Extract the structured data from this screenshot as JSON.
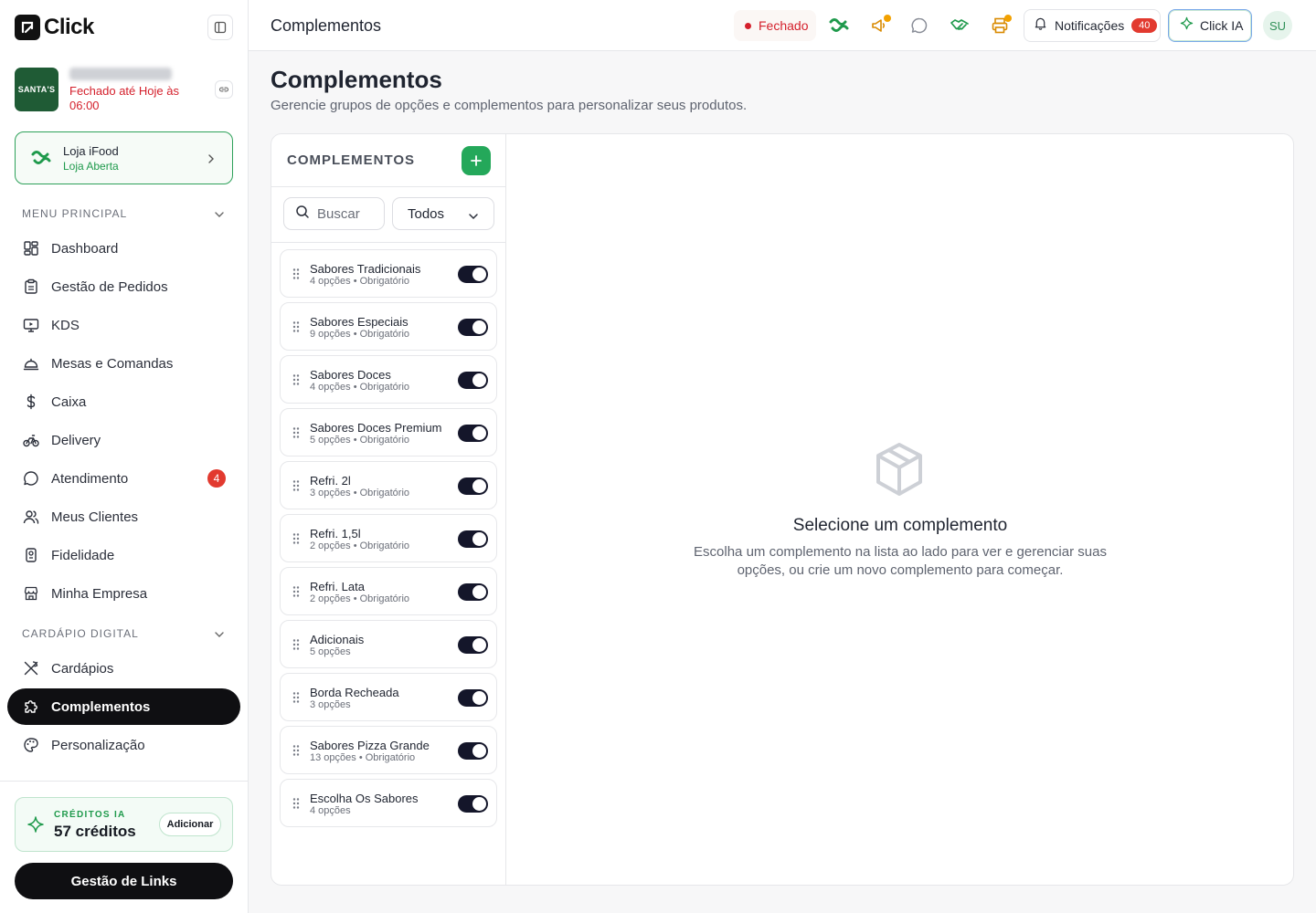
{
  "app": {
    "name": "Click"
  },
  "store": {
    "logo_text": "SANTA'S",
    "status": "Fechado até Hoje às 06:00"
  },
  "ifood_card": {
    "title": "Loja iFood",
    "status": "Loja Aberta"
  },
  "sidebar": {
    "sections": [
      {
        "label": "MENU PRINCIPAL"
      },
      {
        "label": "CARDÁPIO DIGITAL"
      }
    ],
    "items": [
      {
        "label": "Dashboard",
        "icon": "dashboard-icon"
      },
      {
        "label": "Gestão de Pedidos",
        "icon": "clipboard-icon"
      },
      {
        "label": "KDS",
        "icon": "monitor-icon"
      },
      {
        "label": "Mesas e Comandas",
        "icon": "cloche-icon"
      },
      {
        "label": "Caixa",
        "icon": "dollar-icon"
      },
      {
        "label": "Delivery",
        "icon": "bike-icon"
      },
      {
        "label": "Atendimento",
        "icon": "chat-icon",
        "badge": "4"
      },
      {
        "label": "Meus Clientes",
        "icon": "users-icon"
      },
      {
        "label": "Fidelidade",
        "icon": "loyalty-icon"
      },
      {
        "label": "Minha Empresa",
        "icon": "store-icon"
      },
      {
        "label": "Cardápios",
        "icon": "utensils-icon"
      },
      {
        "label": "Complementos",
        "icon": "puzzle-icon",
        "active": true
      },
      {
        "label": "Personalização",
        "icon": "palette-icon"
      }
    ]
  },
  "credits": {
    "label": "CRÉDITOS IA",
    "value": "57 créditos",
    "add_label": "Adicionar"
  },
  "footer": {
    "links_label": "Gestão de Links"
  },
  "topbar": {
    "title": "Complementos",
    "status": "Fechado",
    "notifications_label": "Notificações",
    "notifications_count": "40",
    "ai_label": "Click IA",
    "avatar": "SU"
  },
  "page": {
    "title": "Complementos",
    "subtitle": "Gerencie grupos de opções e complementos para personalizar seus produtos."
  },
  "list": {
    "header": "COMPLEMENTOS",
    "search_placeholder": "Buscar",
    "filter_value": "Todos",
    "groups": [
      {
        "name": "Sabores Tradicionais",
        "meta": "4 opções • Obrigatório",
        "enabled": true
      },
      {
        "name": "Sabores Especiais",
        "meta": "9 opções • Obrigatório",
        "enabled": true
      },
      {
        "name": "Sabores Doces",
        "meta": "4 opções • Obrigatório",
        "enabled": true
      },
      {
        "name": "Sabores Doces Premium",
        "meta": "5 opções • Obrigatório",
        "enabled": true
      },
      {
        "name": "Refri. 2l",
        "meta": "3 opções • Obrigatório",
        "enabled": true
      },
      {
        "name": "Refri. 1,5l",
        "meta": "2 opções • Obrigatório",
        "enabled": true
      },
      {
        "name": "Refri. Lata",
        "meta": "2 opções • Obrigatório",
        "enabled": true
      },
      {
        "name": "Adicionais",
        "meta": "5 opções",
        "enabled": true
      },
      {
        "name": "Borda Recheada",
        "meta": "3 opções",
        "enabled": true
      },
      {
        "name": "Sabores Pizza Grande",
        "meta": "13 opções • Obrigatório",
        "enabled": true
      },
      {
        "name": "Escolha Os Sabores",
        "meta": "4 opções",
        "enabled": true
      }
    ]
  },
  "empty_state": {
    "title": "Selecione um complemento",
    "text": "Escolha um complemento na lista ao lado para ver e gerenciar suas opções, ou crie um novo complemento para começar."
  },
  "colors": {
    "accent": "#24a85a",
    "danger": "#d4202c",
    "dark": "#0f0f12"
  }
}
